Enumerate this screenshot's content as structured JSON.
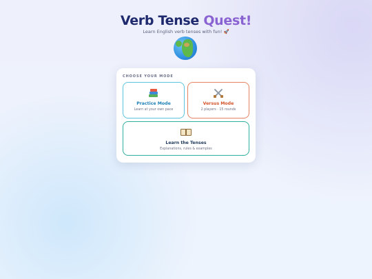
{
  "header": {
    "title_main": "Verb Tense ",
    "title_accent": "Quest!",
    "subtitle": "Learn English verb tenses with fun! 🚀",
    "globe_icon": "globe-africa-europe-icon"
  },
  "card": {
    "choose_label": "CHOOSE YOUR MODE",
    "modes": [
      {
        "icon": "books-icon",
        "title": "Practice Mode",
        "description": "Learn at your own pace",
        "color": "#5cc3de"
      },
      {
        "icon": "crossed-swords-icon",
        "title": "Versus Mode",
        "description": "2 players · 15 rounds",
        "color": "#e5825f"
      },
      {
        "icon": "open-book-icon",
        "title": "Learn the Tenses",
        "description": "Explanations, rules & examples",
        "color": "#2fae9c"
      }
    ]
  },
  "colors": {
    "title": "#1f2a6e",
    "accent": "#8a63d2"
  }
}
